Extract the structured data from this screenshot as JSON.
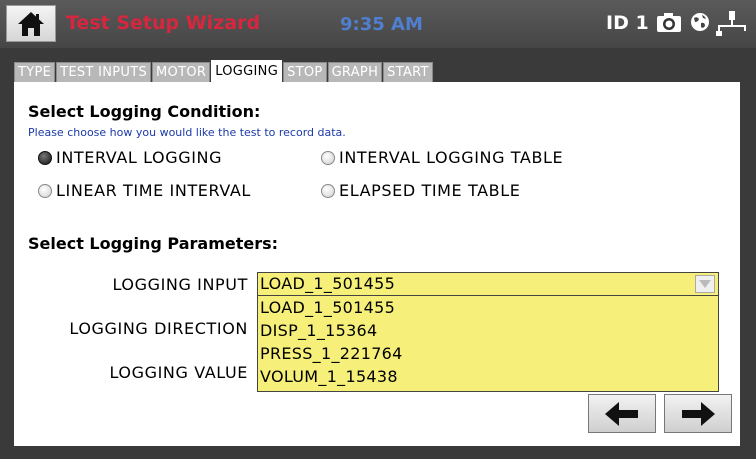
{
  "header": {
    "title": "Test Setup Wizard",
    "time": "9:35 AM",
    "id_label": "ID 1"
  },
  "tabs": [
    {
      "label": "TYPE",
      "active": false
    },
    {
      "label": "TEST INPUTS",
      "active": false
    },
    {
      "label": "MOTOR",
      "active": false
    },
    {
      "label": "LOGGING",
      "active": true
    },
    {
      "label": "STOP",
      "active": false
    },
    {
      "label": "GRAPH",
      "active": false
    },
    {
      "label": "START",
      "active": false
    }
  ],
  "condition": {
    "heading": "Select Logging Condition:",
    "hint": "Please choose how you would like the test to record data.",
    "options": [
      {
        "label": "INTERVAL LOGGING",
        "selected": true
      },
      {
        "label": "INTERVAL LOGGING TABLE",
        "selected": false
      },
      {
        "label": "LINEAR TIME INTERVAL",
        "selected": false
      },
      {
        "label": "ELAPSED TIME TABLE",
        "selected": false
      }
    ]
  },
  "parameters": {
    "heading": "Select Logging Parameters:",
    "input_label": "LOGGING INPUT",
    "direction_label": "LOGGING DIRECTION",
    "value_label": "LOGGING VALUE",
    "input_value": "LOAD_1_501455",
    "input_options": [
      "LOAD_1_501455",
      "DISP_1_15364",
      "PRESS_1_221764",
      "VOLUM_1_15438"
    ]
  },
  "colors": {
    "title": "#d7263d",
    "clock": "#4f7fd1",
    "dropdown": "#f6f07a",
    "hint": "#1c3aa8"
  },
  "icons": [
    "home-icon",
    "camera-icon",
    "globe-icon",
    "network-icon",
    "back-arrow-icon",
    "next-arrow-icon"
  ]
}
